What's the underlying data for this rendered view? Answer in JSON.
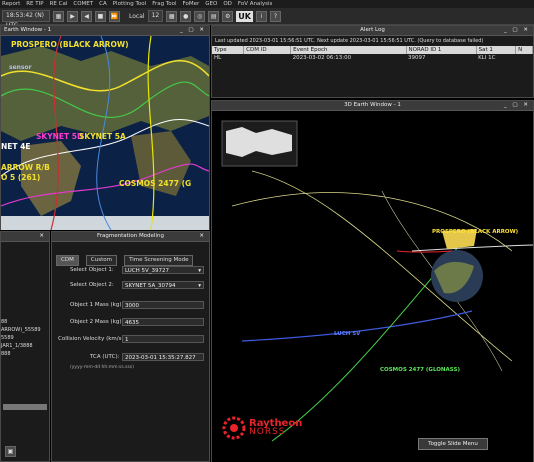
{
  "menubar": [
    "Report",
    "RE TIP",
    "RE Cal",
    "COMET",
    "CA",
    "Plotting Tool",
    "Frag Tool",
    "FoMer",
    "GEO",
    "OD",
    "FoV Analysis"
  ],
  "toolbar": {
    "datetime": "18:53:42 (N) UTC",
    "local_label": "Local",
    "local_value": "12",
    "uk_label": "UK"
  },
  "earth2d": {
    "title": "Earth Window - 1",
    "labels": {
      "prospero": "PROSPERO (BLACK ARROW)",
      "sensor": "sensor",
      "skynet5d": "SKYNET 5D",
      "skynet5a": "SKYNET 5A",
      "net4e": "NET 4E",
      "arrow_rb": "ARROW R/B",
      "os261": "O 5 (261)",
      "cosmos": "COSMOS 2477 (G"
    }
  },
  "alert_log": {
    "title": "Alert Log",
    "status_text": "Last updated 2023-03-01 15:56:51 UTC. Next update 2023-03-01 15:56:51 UTC. (Query to database failed)",
    "columns": [
      "Type",
      "CDM ID",
      "Event Epoch",
      "NORAD ID 1",
      "Sat 1",
      "N"
    ],
    "rows": [
      [
        "HL",
        "",
        "2023-03-02 06:13:00",
        "39097",
        "KLI 1C",
        ""
      ]
    ]
  },
  "earth3d": {
    "title": "3D Earth Window - 1",
    "labels": {
      "prospero": "PROSPERO (BLACK ARROW)",
      "luch": "LUCH 5V",
      "cosmos": "COSMOS 2477 (GLONASS)"
    },
    "toggle_button": "Toggle Slide Menu"
  },
  "left_list": {
    "items": [
      "88",
      "ARROW)_55589",
      "5589",
      "JAR1_1/3888",
      "888"
    ]
  },
  "frag": {
    "title": "Fragmentation Modeling",
    "tabs": [
      "CDM",
      "Custom",
      "Time Screening Mode"
    ],
    "select1_label": "Select Object 1:",
    "select1_value": "LUCH 5V_39727",
    "select2_label": "Select Object 2:",
    "select2_value": "SKYNET 5A_30794",
    "mass1_label": "Object 1 Mass (kg):",
    "mass1_value": "3000",
    "mass2_label": "Object 2 Mass (kg):",
    "mass2_value": "4635",
    "velocity_label": "Collision Velocity (km/s):",
    "velocity_value": "1",
    "tca_label": "TCA (UTC):",
    "tca_value": "2023-03-01 15:35:27.827",
    "tca_hint": "(yyyy-mm-dd hh:mm:ss.sss)"
  },
  "brand": {
    "name": "Raytheon",
    "sub": "NORSS"
  },
  "colors": {
    "accent_yellow": "#f2e02e",
    "brand_red": "#e8232a"
  }
}
